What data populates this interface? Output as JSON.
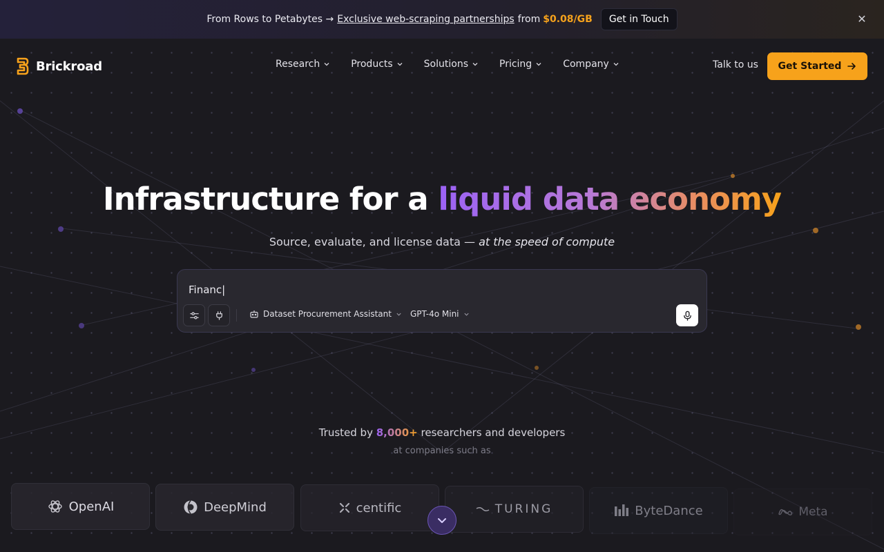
{
  "banner": {
    "text": "From Rows to Petabytes →",
    "link_text": "Exclusive web-scraping partnerships",
    "from_text": "from",
    "price": "$0.08/GB",
    "cta_label": "Get in Touch",
    "close_icon": "close-icon"
  },
  "header": {
    "brand": "Brickroad",
    "nav": [
      {
        "label": "Research"
      },
      {
        "label": "Products"
      },
      {
        "label": "Solutions"
      },
      {
        "label": "Pricing"
      },
      {
        "label": "Company"
      }
    ],
    "talk_label": "Talk to us",
    "get_started_label": "Get Started"
  },
  "hero": {
    "title_plain": "Infrastructure for a ",
    "title_gradient": "liquid data economy",
    "subtitle_plain": "Source, evaluate, and license data — ",
    "subtitle_italic": "at the speed of compute"
  },
  "search": {
    "value": "Financ|",
    "assistant_label": "Dataset Procurement Assistant",
    "model_label": "GPT-4o Mini"
  },
  "trusted": {
    "prefix": "Trusted by ",
    "count": "8,000+",
    "suffix": " researchers and developers",
    "sub": "at companies such as"
  },
  "companies": [
    {
      "name": "OpenAI"
    },
    {
      "name": "DeepMind"
    },
    {
      "name": "centific"
    },
    {
      "name": "TURING"
    },
    {
      "name": "ByteDance"
    },
    {
      "name": "Meta"
    }
  ],
  "colors": {
    "accent_orange": "#f7a21b",
    "accent_purple": "#9b62f5",
    "background": "#1b1a1f"
  }
}
